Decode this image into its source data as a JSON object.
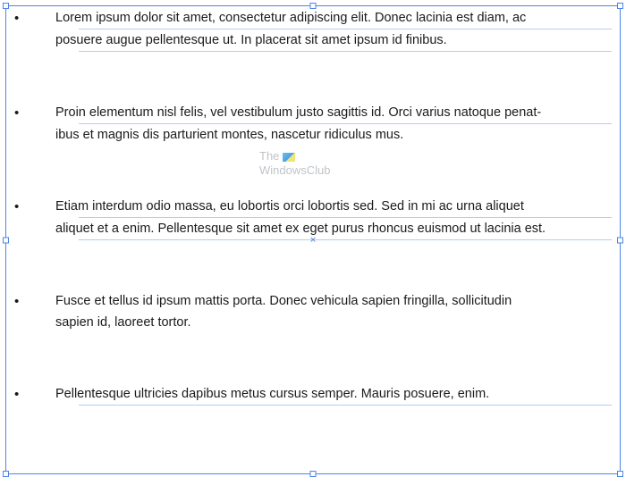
{
  "bullets": [
    {
      "lines": [
        "Lorem ipsum dolor sit amet, consectetur adipiscing elit. Donec lacinia est diam, ac",
        "posuere augue pellentesque ut. In placerat sit amet ipsum id finibus."
      ],
      "underlined": [
        true,
        true
      ]
    },
    {
      "lines": [
        "Proin elementum nisl felis, vel vestibulum justo sagittis id. Orci varius natoque penat-",
        "ibus et magnis dis parturient montes, nascetur ridiculus mus."
      ],
      "underlined": [
        true,
        false
      ]
    },
    {
      "lines": [
        "Etiam interdum odio massa, eu lobortis orci lobortis sed. Sed in mi ac urna aliquet",
        "aliquet et a enim. Pellentesque sit amet ex eget purus rhoncus euismod ut lacinia est."
      ],
      "underlined": [
        true,
        true
      ]
    },
    {
      "lines": [
        "Fusce et tellus id ipsum mattis porta. Donec vehicula sapien fringilla, sollicitudin",
        "sapien id, laoreet tortor."
      ],
      "underlined": [
        false,
        false
      ]
    },
    {
      "lines": [
        "Pellentesque ultricies dapibus metus cursus semper. Mauris posuere, enim."
      ],
      "underlined": [
        true
      ]
    }
  ],
  "bullet_char": "•",
  "watermark": {
    "line1": "The",
    "line2": "WindowsClub"
  },
  "selection_color": "#4a86e8"
}
